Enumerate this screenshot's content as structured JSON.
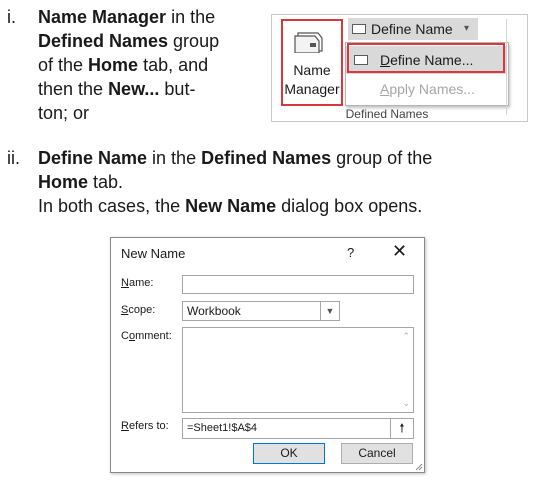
{
  "steps": {
    "i_marker": "i.",
    "i_lines": [
      [
        {
          "t": "Name Manager",
          "b": true
        },
        {
          "t": " in the",
          "b": false
        }
      ],
      [
        {
          "t": "Defined Names",
          "b": true
        },
        {
          "t": " group",
          "b": false
        }
      ],
      [
        {
          "t": "of the ",
          "b": false
        },
        {
          "t": "Home",
          "b": true
        },
        {
          "t": " tab, and",
          "b": false
        }
      ],
      [
        {
          "t": "then the ",
          "b": false
        },
        {
          "t": "New...",
          "b": true
        },
        {
          "t": " but-",
          "b": false
        }
      ],
      [
        {
          "t": "ton; or",
          "b": false
        }
      ]
    ],
    "ii_marker": "ii.",
    "ii_lines": [
      [
        {
          "t": "Define Name",
          "b": true
        },
        {
          "t": " in the ",
          "b": false
        },
        {
          "t": "Defined Names",
          "b": true
        },
        {
          "t": " group of the",
          "b": false
        }
      ],
      [
        {
          "t": "Home",
          "b": true
        },
        {
          "t": " tab.",
          "b": false
        }
      ],
      [
        {
          "t": "In both cases, the ",
          "b": false
        },
        {
          "t": "New Name",
          "b": true
        },
        {
          "t": " dialog box opens.",
          "b": false
        }
      ]
    ]
  },
  "ribbon": {
    "name_manager_line1": "Name",
    "name_manager_line2": "Manager",
    "define_name_button": "Define Name",
    "define_name_arrow": "▾",
    "menu_define_name": "Define Name...",
    "menu_apply_names": "Apply Names...",
    "group_label": "Defined Names",
    "highlight_color": "#d9363e"
  },
  "dialog": {
    "title": "New Name",
    "help": "?",
    "close": "✕",
    "name_label": "Name:",
    "name_value": "",
    "scope_label": "Scope:",
    "scope_value": "Workbook",
    "comment_label": "Comment:",
    "comment_value": "",
    "refers_label": "Refers to:",
    "refers_value": "=Sheet1!$A$4",
    "ok": "OK",
    "cancel": "Cancel"
  }
}
